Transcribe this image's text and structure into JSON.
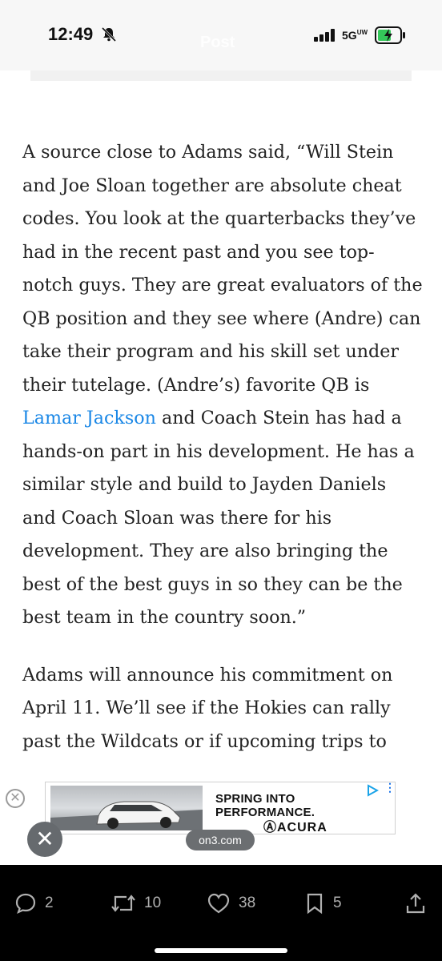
{
  "status_bar": {
    "time": "12:49",
    "network": "5G",
    "network_sup": "UW",
    "faded_title": "Post"
  },
  "article": {
    "paragraph1_before_link": "A source close to Adams said, “Will Stein and Joe Sloan together are absolute cheat codes. You look at the quarterbacks they’ve had in the recent past and you see top-notch guys. They are great evaluators of the QB position and they see where (Andre) can take their program and his skill set under their tutelage. (Andre’s) favorite QB is ",
    "link_text": "Lamar Jackson",
    "paragraph1_after_link": " and Coach Stein has had a hands-on part in his development. He has a similar style and build to Jayden Daniels and Coach Sloan was there for his development. They are also bringing the best of the best guys in so they can be the best team in the country soon.”",
    "paragraph2": "Adams will announce his commitment on April 11. We’ll see if the Hokies can rally past the Wildcats or if upcoming trips to"
  },
  "ad": {
    "headline": "SPRING INTO PERFORMANCE.",
    "brand": "ⒶACURA",
    "close_glyph": "✕"
  },
  "overlay": {
    "url": "on3.com",
    "close_glyph": "✕"
  },
  "toolbar": {
    "replies": "2",
    "reposts": "10",
    "likes": "38",
    "bookmarks": "5"
  },
  "colors": {
    "link": "#1a87e6",
    "toolbar_bg": "#000000",
    "toolbar_icon": "#b0b0b0"
  },
  "icons": [
    "bell-off-icon",
    "signal-icon",
    "battery-icon",
    "reply-icon",
    "repost-icon",
    "like-icon",
    "bookmark-icon",
    "share-icon",
    "ad-choices-icon"
  ]
}
